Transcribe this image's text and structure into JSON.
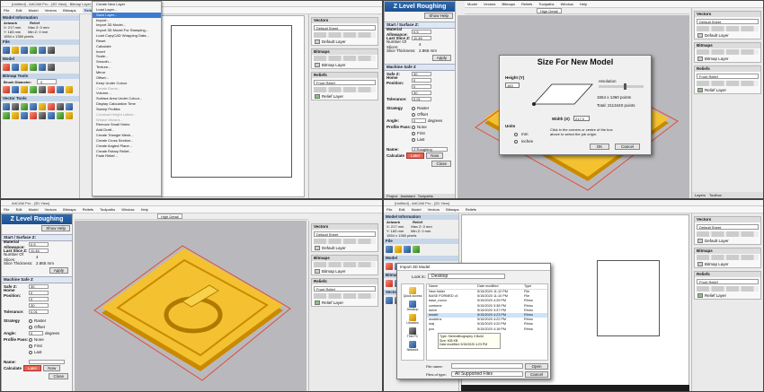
{
  "colors": {
    "accent_blue": "#1d4f8e",
    "menu_highlight": "#3a7bd5",
    "relief_yellow": "#f4c230",
    "relief_edge": "#c98a00",
    "red_button": "#e7624d",
    "viewport_gray": "#b9b9bd"
  },
  "q1": {
    "title": "[Untitled] - ArtCAM Pro - [3D View] - Bitmap Layer",
    "menus": [
      "File",
      "Edit",
      "Model",
      "Vectors",
      "Bitmaps",
      "Reliefs"
    ],
    "active_menu": "Reliefs",
    "left": {
      "model_information": "Model Information",
      "artwork": "Artwork",
      "relief": "Relief",
      "info_lines": [
        "X: 217 mm",
        "Y: 183 mm",
        "1554 x 1360 pixels"
      ],
      "info_right": [
        "Max Z: 0 mm",
        "Min Z: 0 mm"
      ],
      "file": "File",
      "model": "Model",
      "bitmap_tools": "Bitmap Tools",
      "brush_diameter": "Brush Diameter:",
      "brush_value": "0",
      "vector_tools": "Vector Tools"
    },
    "menu_items": [
      "Create New Layer",
      "Load Layer...",
      "Save Layer...",
      "Import...",
      "Import 3D Model...",
      "Import 3D Model For Stamping...",
      "Load CopyCAD Wrapping Data...",
      "Reset",
      "Calculate",
      "Invert",
      "Scale...",
      "Smooth...",
      "Texture...",
      "Mirror",
      "Offset...",
      "Keep Under Colour",
      "Create Dome...",
      "Volume...",
      "Surface Area Under Colour...",
      "Display Calculation Time",
      "Sweep Profiles",
      "Constant Height Lattice...",
      "Weave Wizard...",
      "Remove Small Holes",
      "Add Draft...",
      "Create Triangle Mesh...",
      "Create Cross Section...",
      "Create Angled Plane...",
      "Create Rotary Relief...",
      "Fade Relief..."
    ],
    "menu_highlight_index": 2,
    "menu_disabled": [
      16,
      21,
      22
    ],
    "right": {
      "vectors": "Vectors",
      "vector_sheet": "Default Sheet",
      "default_layer": "Default Layer",
      "bitmaps": "Bitmaps",
      "bitmap_layer": "Bitmap Layer",
      "reliefs": "Reliefs",
      "front_relief": "Front Relief",
      "relief_layer": "Relief Layer"
    }
  },
  "q2": {
    "panel_title": "Z Level Roughing",
    "show_help": "Show Help",
    "section_start": "Start / Surface Z:",
    "material_allowance_label": "Material Allowance:",
    "material_allowance": "0.5",
    "last_slice_label": "Last Slice Z:",
    "last_slice": "11.46",
    "slices_label": "Number Of Slices:",
    "slices": "4",
    "thickness_label": "Slice Thickness:",
    "thickness": "2.865 mm",
    "apply": "Apply",
    "section_safe": "Machine Safe Z",
    "safe_z_label": "Safe Z:",
    "safe_z": "30",
    "home_label": "Home Position:",
    "home_x": "0",
    "home_y": "0",
    "home_z": "30",
    "tolerance_label": "Tolerance:",
    "tolerance": "0.01",
    "strategy_label": "Strategy",
    "raster": "Raster",
    "offset": "Offset",
    "angle_label": "Angle:",
    "angle": "0",
    "degrees": "degrees",
    "profile_label": "Profile Pass:",
    "none": "None",
    "first": "First",
    "last": "Last",
    "name_label": "Name:",
    "name_value": "Z Roughing",
    "calculate": "Calculate",
    "later": "Later",
    "now": "Now",
    "close": "Close",
    "tabs": [
      "Project",
      "Assistant",
      "Toolpaths"
    ],
    "dialog": {
      "title": "Size For New Model",
      "height_label": "Height (Y)",
      "height": "183",
      "width_label": "Width (X)",
      "width": "217.0",
      "resolution": "resolution",
      "points": "1554 x 1360 points",
      "total": "Total: 2113440 points",
      "units": "Units",
      "mm": "mm",
      "inches": "inches",
      "hint": "Click in the corners or centre of the box above to select the job origin.",
      "ok": "OK",
      "cancel": "Cancel"
    },
    "right_tabs": [
      "Layers",
      "Toolbox"
    ],
    "menus": [
      "Model",
      "Vectors",
      "Bitmaps",
      "Reliefs",
      "Toolpaths",
      "Window",
      "Help"
    ],
    "detail": "High Detail"
  },
  "q3": {
    "title": "ArtCAM Pro - [3D View]",
    "menus": [
      "File",
      "Edit",
      "Model",
      "Vectors",
      "Bitmaps",
      "Reliefs",
      "Toolpaths",
      "Window",
      "Help"
    ],
    "detail": "High Detail"
  },
  "q4": {
    "title": "[Untitled] - ArtCAM Pro - [2D View]",
    "dialog": {
      "title": "Import 3D Model",
      "look_in_label": "Look in:",
      "look_in": "Desktop",
      "places": [
        "Quick access",
        "Desktop",
        "Libraries",
        "This PC",
        "Network"
      ],
      "col_name": "Name",
      "col_date": "Date modified",
      "col_type": "Type",
      "files": [
        {
          "name": "New folder",
          "date": "5/15/2020 11:12 PM",
          "type": "File"
        },
        {
          "name": "BASE FORMED v1",
          "date": "5/15/2020 11:10 PM",
          "type": "File"
        },
        {
          "name": "base_mono",
          "date": "5/15/2020 4:25 PM",
          "type": "Rhino"
        },
        {
          "name": "contome",
          "date": "5/15/2020 3:38 PM",
          "type": "Rhino"
        },
        {
          "name": "dulce",
          "date": "5/15/2020 3:37 PM",
          "type": "Rhino"
        },
        {
          "name": "model",
          "date": "5/15/2020 4:23 PM",
          "type": "Rhino"
        },
        {
          "name": "modelnz",
          "date": "5/15/2020 4:22 PM",
          "type": "Rhino"
        },
        {
          "name": "maj",
          "date": "5/15/2020 4:20 PM",
          "type": "Rhino"
        },
        {
          "name": "pzo",
          "date": "5/15/2020 4:18 PM",
          "type": "Rhino"
        }
      ],
      "tooltip": [
        "Type: Stereolithography 3 Build",
        "Size: 605 KB",
        "Date modified: 5/15/2020 4:23 PM"
      ],
      "file_name_label": "File name:",
      "file_type_label": "Files of type:",
      "file_type": "All Supported Files",
      "open": "Open",
      "cancel": "Cancel"
    }
  }
}
